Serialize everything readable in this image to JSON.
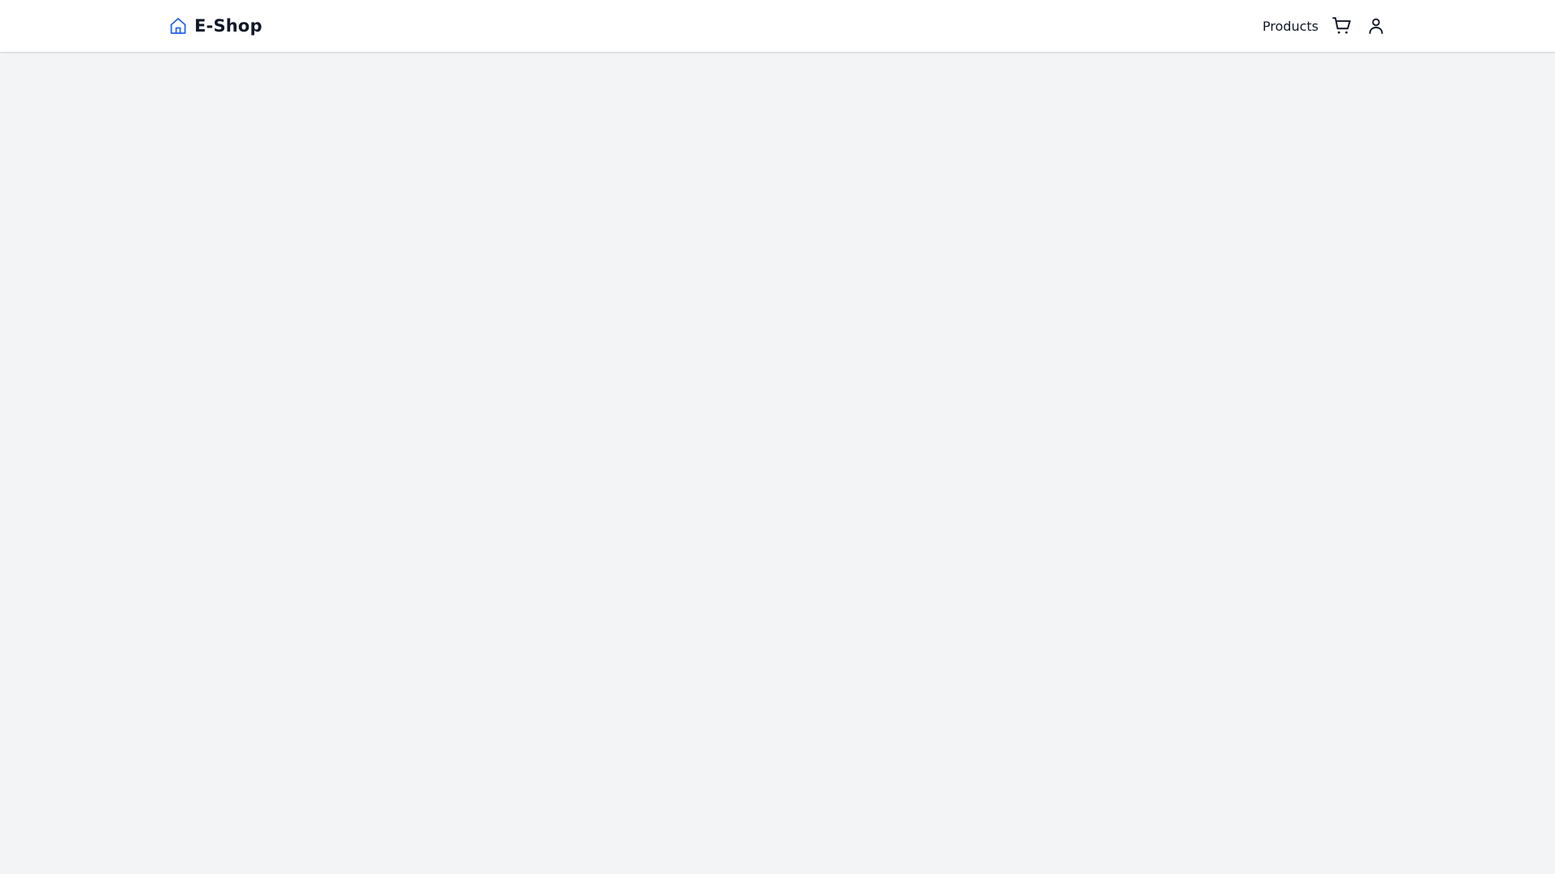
{
  "app": {
    "title": "E-Shop",
    "brand_icon": "home-icon",
    "accent_color": "#2563eb"
  },
  "nav": {
    "links": [
      {
        "label": "Products"
      }
    ],
    "icons": [
      "cart-icon",
      "user-icon"
    ]
  }
}
